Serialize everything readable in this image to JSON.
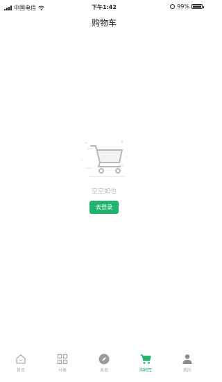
{
  "status_bar": {
    "carrier": "中国电信",
    "time": "下午1:42",
    "battery": "99%",
    "battery_level": 0.99
  },
  "header": {
    "title": "购物车"
  },
  "empty_state": {
    "message": "空空如也",
    "button_label": "去登录"
  },
  "colors": {
    "accent": "#22b36e",
    "inactive": "#aaaaaa"
  },
  "tabbar": {
    "items": [
      {
        "label": "首页",
        "icon": "home-icon"
      },
      {
        "label": "分类",
        "icon": "grid-icon"
      },
      {
        "label": "发现",
        "icon": "compass-icon"
      },
      {
        "label": "购物车",
        "icon": "cart-icon",
        "active": true
      },
      {
        "label": "我的",
        "icon": "person-icon"
      }
    ]
  }
}
